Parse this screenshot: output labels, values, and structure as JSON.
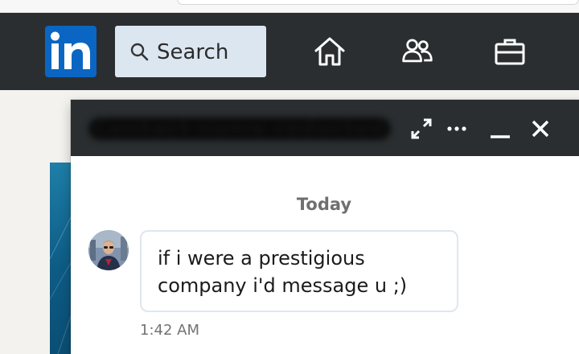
{
  "nav": {
    "logo_text": "in",
    "search_label": "Search",
    "icons": [
      "home-icon",
      "my-network-icon",
      "jobs-icon"
    ]
  },
  "chat": {
    "contact_name": "Contact name redacted",
    "date_separator": "Today",
    "message_text": "if i were a prestigious company i'd message u ;)",
    "message_time": "1:42 AM"
  },
  "colors": {
    "nav_bg": "#2a2e30",
    "logo_blue": "#0a66c2",
    "search_bg": "#dce6f1"
  }
}
